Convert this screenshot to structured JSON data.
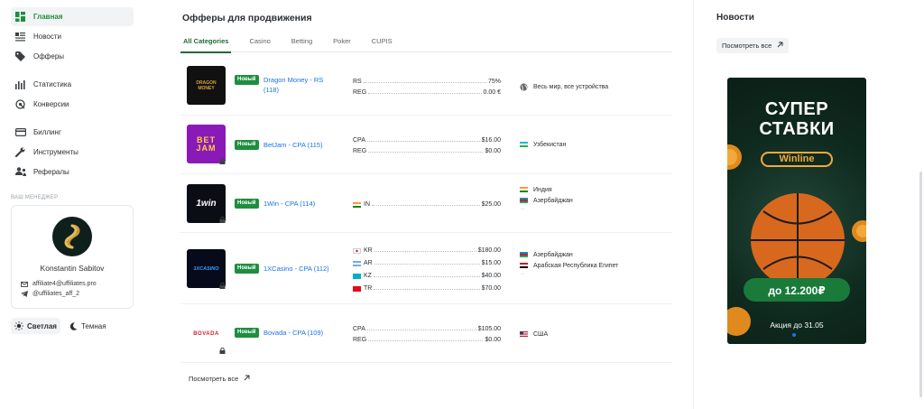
{
  "sidebar": {
    "items": [
      {
        "label": "Главная",
        "icon": "dashboard-icon",
        "active": true
      },
      {
        "label": "Новости",
        "icon": "news-icon"
      },
      {
        "label": "Офферы",
        "icon": "tag-icon"
      },
      {
        "label": "Статистика",
        "icon": "bar-chart-icon"
      },
      {
        "label": "Конверсии",
        "icon": "conversion-icon"
      },
      {
        "label": "Биллинг",
        "icon": "card-icon"
      },
      {
        "label": "Инструменты",
        "icon": "wrench-icon"
      },
      {
        "label": "Рефералы",
        "icon": "referral-icon"
      }
    ],
    "manager": {
      "title": "ВАШ МЕНЕДЖЕР",
      "name": "Konstantin Sabitov",
      "email": "affiliate4@uffiliates.pro",
      "telegram": "@uffiliates_aff_2"
    },
    "theme": {
      "light": "Светлая",
      "dark": "Темная",
      "selected": "light"
    }
  },
  "offers": {
    "title": "Офферы для продвижения",
    "tabs": [
      "All Categories",
      "Casino",
      "Betting",
      "Poker",
      "CUPIS"
    ],
    "active_tab": "All Categories",
    "badge": "Новый",
    "rows": [
      {
        "logo_text": "DRAGON MONEY",
        "name": "Dragon Money - RS (118)",
        "metrics": [
          {
            "label": "RS",
            "value": "75%"
          },
          {
            "label": "REG",
            "value": "0.00 €"
          }
        ],
        "geo": [
          {
            "label": "Весь мир, все устройства",
            "icon": "globe-icon"
          }
        ]
      },
      {
        "logo_text": "BET JAM",
        "name": "BetJam - CPA (115)",
        "metrics": [
          {
            "label": "CPA",
            "value": "$16.00"
          },
          {
            "label": "REG",
            "value": "$0.00"
          }
        ],
        "geo": [
          {
            "label": "Узбекистан",
            "flag": "uz"
          }
        ]
      },
      {
        "logo_text": "1win",
        "name": "1Win - CPA (114)",
        "metrics": [
          {
            "label": "IN",
            "value": "$25.00",
            "flag": "in"
          }
        ],
        "geo": [
          {
            "label": "Индия",
            "flag": "in"
          },
          {
            "label": "Азербайджан",
            "flag": "az"
          }
        ],
        "geo_more": "..."
      },
      {
        "logo_text": "1XCASINO",
        "name": "1XCasino - CPA (112)",
        "metrics": [
          {
            "label": "KR",
            "value": "$180.00",
            "flag": "kr"
          },
          {
            "label": "AR",
            "value": "$15.00",
            "flag": "ar"
          },
          {
            "label": "KZ",
            "value": "$40.00",
            "flag": "kz"
          },
          {
            "label": "TR",
            "value": "$70.00",
            "flag": "tr"
          }
        ],
        "geo": [
          {
            "label": "Азербайджан",
            "flag": "az"
          },
          {
            "label": "Арабская Республика Египет",
            "flag": "eg"
          }
        ],
        "geo_more": "..."
      },
      {
        "logo_text": "BOVADA",
        "name": "Bovada - CPA (109)",
        "metrics": [
          {
            "label": "CPA",
            "value": "$105.00"
          },
          {
            "label": "REG",
            "value": "$0.00"
          }
        ],
        "geo": [
          {
            "label": "США",
            "flag": "us"
          }
        ]
      }
    ],
    "see_all": "Посмотреть все"
  },
  "news": {
    "title": "Новости",
    "see_all": "Посмотреть все",
    "banner": {
      "headline_1": "СУПЕР",
      "headline_2": "СТАВКИ",
      "brand": "Winline",
      "amount": "до 12.200₽",
      "footer": "Акция до 31.05"
    }
  },
  "colors": {
    "accent": "#1e8e3e",
    "link": "#1a73e8",
    "banner_green": "#1a3d2e"
  }
}
